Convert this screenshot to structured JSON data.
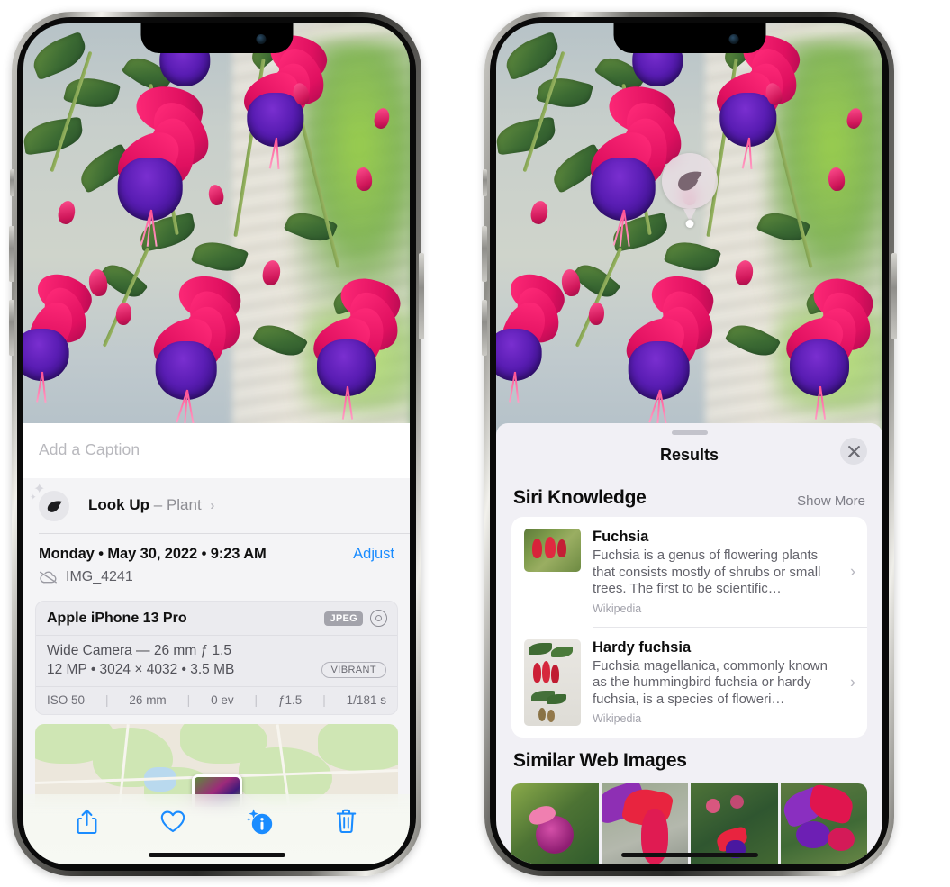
{
  "left_phone": {
    "caption_field": {
      "placeholder": "Add a Caption",
      "value": ""
    },
    "look_up": {
      "label": "Look Up",
      "dash": "–",
      "subject": "Plant",
      "chevron": "›",
      "icon": "leaf-icon"
    },
    "date_time": "Monday • May 30, 2022 • 9:23 AM",
    "adjust_label": "Adjust",
    "file_name": "IMG_4241",
    "icloud_icon": "cloud-slash-icon",
    "exif": {
      "device": "Apple iPhone 13 Pro",
      "format_badge": "JPEG",
      "lens_line": "Wide Camera — 26 mm ƒ 1.5",
      "resolution_line": "12 MP • 3024 × 4032 • 3.5 MB",
      "style_badge": "VIBRANT",
      "stats": [
        "ISO 50",
        "26 mm",
        "0 ev",
        "ƒ1.5",
        "1/181 s"
      ]
    },
    "toolbar": [
      {
        "name": "share-button",
        "icon": "share-icon",
        "active": false
      },
      {
        "name": "favorite-button",
        "icon": "heart-icon",
        "active": false
      },
      {
        "name": "info-button",
        "icon": "info-sparkle-icon",
        "active": true
      },
      {
        "name": "delete-button",
        "icon": "trash-icon",
        "active": false
      }
    ]
  },
  "right_phone": {
    "visual_lookup_badge": {
      "icon": "leaf-icon"
    },
    "sheet_title": "Results",
    "close_button": "close-icon",
    "siri_knowledge": {
      "title": "Siri Knowledge",
      "show_more": "Show More",
      "items": [
        {
          "title": "Fuchsia",
          "description": "Fuchsia is a genus of flowering plants that consists mostly of shrubs or small trees. The first to be scientific…",
          "source": "Wikipedia"
        },
        {
          "title": "Hardy fuchsia",
          "description": "Fuchsia magellanica, commonly known as the hummingbird fuchsia or hardy fuchsia, is a species of floweri…",
          "source": "Wikipedia"
        }
      ]
    },
    "similar_web_images": {
      "title": "Similar Web Images",
      "count": 4
    }
  },
  "colors": {
    "accent_blue": "#1a8cff",
    "sheet_bg": "#f1f0f5",
    "info_bg": "#f4f4f6",
    "card_white": "#ffffff",
    "secondary_text": "#63636b"
  }
}
